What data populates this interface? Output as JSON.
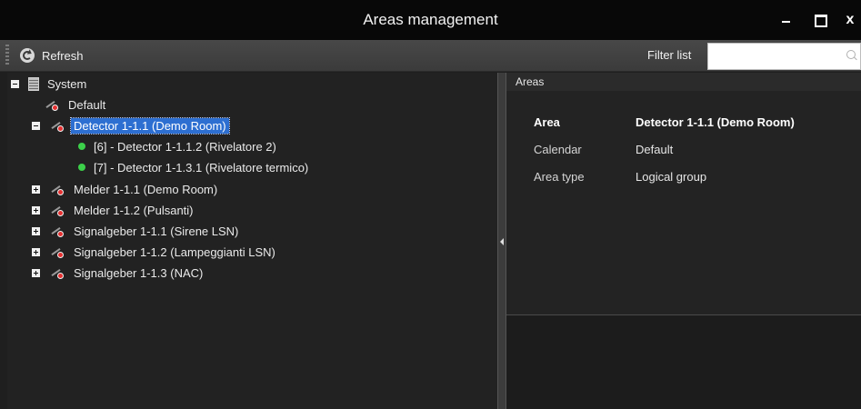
{
  "window": {
    "title": "Areas management",
    "controls": {
      "minimize": "–",
      "maximize": "□",
      "close": "x"
    }
  },
  "toolbar": {
    "refresh_label": "Refresh",
    "filter_label": "Filter list",
    "filter_value": "",
    "filter_placeholder": ""
  },
  "tree": {
    "root": {
      "label": "System",
      "expanded": true
    },
    "items": [
      {
        "label": "Default",
        "expander": "none",
        "icon": "area-icon"
      },
      {
        "label": "Detector 1-1.1 (Demo Room)",
        "expander": "minus",
        "icon": "area-icon",
        "selected": true
      },
      {
        "label": "[6] - Detector 1-1.1.2 (Rivelatore 2)",
        "expander": "none",
        "icon": "status-dot-icon",
        "status_color": "#3cd04a"
      },
      {
        "label": "[7] - Detector 1-1.3.1 (Rivelatore termico)",
        "expander": "none",
        "icon": "status-dot-icon",
        "status_color": "#3cd04a"
      },
      {
        "label": "Melder 1-1.1 (Demo Room)",
        "expander": "plus",
        "icon": "area-icon"
      },
      {
        "label": "Melder 1-1.2 (Pulsanti)",
        "expander": "plus",
        "icon": "area-icon"
      },
      {
        "label": "Signalgeber 1-1.1 (Sirene LSN)",
        "expander": "plus",
        "icon": "area-icon"
      },
      {
        "label": "Signalgeber 1-1.2 (Lampeggianti LSN)",
        "expander": "plus",
        "icon": "area-icon"
      },
      {
        "label": "Signalgeber 1-1.3 (NAC)",
        "expander": "plus",
        "icon": "area-icon"
      }
    ]
  },
  "details": {
    "header": "Areas",
    "properties": [
      {
        "key": "Area",
        "value": "Detector 1-1.1 (Demo Room)"
      },
      {
        "key": "Calendar",
        "value": "Default"
      },
      {
        "key": "Area type",
        "value": "Logical group"
      }
    ]
  },
  "colors": {
    "selection": "#2d6fd1",
    "status_ok": "#3cd04a",
    "alarm_red": "#e53030"
  }
}
